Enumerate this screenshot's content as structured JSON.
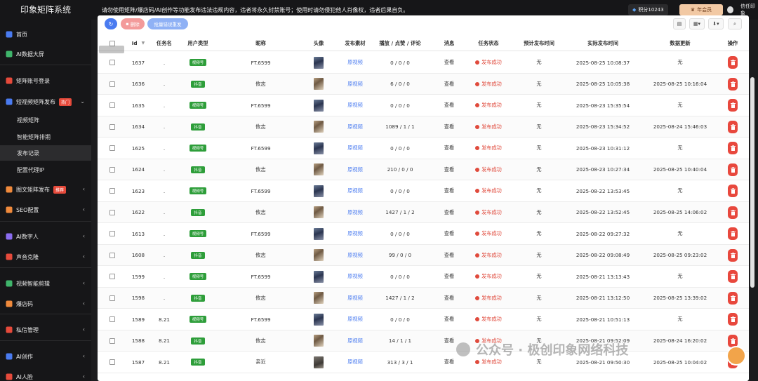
{
  "app": {
    "brand": "印象矩阵系统",
    "notice": "请勿使用矩阵/爆店码/AI创作等功能发布违法违规内容，违者将永久封禁账号；使用时请勿侵犯他人肖像权，违者后果自负。",
    "points": "积分10243",
    "vip_label": "年会员",
    "user_name": "信任印象"
  },
  "sidebar": {
    "items": [
      {
        "label": "首页",
        "icon": "home-icon"
      },
      {
        "label": "AI数据大屏",
        "icon": "screen-icon"
      },
      {
        "label": "矩阵账号登录",
        "icon": "account-icon"
      },
      {
        "label": "短视频矩阵发布",
        "icon": "video-icon",
        "badge": "热门"
      },
      {
        "label": "视频矩阵"
      },
      {
        "label": "智能矩阵排期"
      },
      {
        "label": "发布记录"
      },
      {
        "label": "配置代理IP"
      },
      {
        "label": "图文矩阵发布",
        "icon": "image-icon",
        "badge": "推荐"
      },
      {
        "label": "SEO配置",
        "icon": "seo-icon"
      },
      {
        "label": "AI数字人",
        "icon": "robot-icon"
      },
      {
        "label": "声音克隆",
        "icon": "voice-icon"
      },
      {
        "label": "视频智能剪辑",
        "icon": "clip-icon"
      },
      {
        "label": "爆店码",
        "icon": "qr-icon"
      },
      {
        "label": "私信管理",
        "icon": "message-icon"
      },
      {
        "label": "AI创作",
        "icon": "ai-icon"
      },
      {
        "label": "AI人脸",
        "icon": "face-icon"
      }
    ]
  },
  "toolbar": {
    "delete_label": "删除",
    "batch_label": "批量错误重发"
  },
  "table": {
    "headers": [
      "Id",
      "任务名",
      "用户类型",
      "昵称",
      "头像",
      "发布素材",
      "播放 / 点赞 / 评论",
      "消息",
      "任务状态",
      "预计发布时间",
      "实际发布时间",
      "数据更新",
      "操作"
    ],
    "rows": [
      {
        "id": "1637",
        "task": ".",
        "type": "视频号",
        "nick": "FT.6599",
        "avatar": "a",
        "material": "原视频",
        "stats": "0 / 0 / 0",
        "msg": "查看",
        "status": "发布成功",
        "planned": "无",
        "actual": "2025-08-25 10:08:37",
        "update": "无"
      },
      {
        "id": "1636",
        "task": ".",
        "type": "抖音",
        "nick": "攸志",
        "avatar": "b",
        "material": "原视频",
        "stats": "6 / 0 / 0",
        "msg": "查看",
        "status": "发布成功",
        "planned": "无",
        "actual": "2025-08-25 10:05:38",
        "update": "2025-08-25 10:16:04"
      },
      {
        "id": "1635",
        "task": ".",
        "type": "视频号",
        "nick": "FT.6599",
        "avatar": "a",
        "material": "原视频",
        "stats": "0 / 0 / 0",
        "msg": "查看",
        "status": "发布成功",
        "planned": "无",
        "actual": "2025-08-23 15:35:54",
        "update": "无"
      },
      {
        "id": "1634",
        "task": ".",
        "type": "抖音",
        "nick": "攸志",
        "avatar": "b",
        "material": "原视频",
        "stats": "1089 / 1 / 1",
        "msg": "查看",
        "status": "发布成功",
        "planned": "无",
        "actual": "2025-08-23 15:34:52",
        "update": "2025-08-24 15:46:03"
      },
      {
        "id": "1625",
        "task": ".",
        "type": "视频号",
        "nick": "FT.6599",
        "avatar": "a",
        "material": "原视频",
        "stats": "0 / 0 / 0",
        "msg": "查看",
        "status": "发布成功",
        "planned": "无",
        "actual": "2025-08-23 10:31:12",
        "update": "无"
      },
      {
        "id": "1624",
        "task": ".",
        "type": "抖音",
        "nick": "攸志",
        "avatar": "b",
        "material": "原视频",
        "stats": "210 / 0 / 0",
        "msg": "查看",
        "status": "发布成功",
        "planned": "无",
        "actual": "2025-08-23 10:27:34",
        "update": "2025-08-25 10:40:04"
      },
      {
        "id": "1623",
        "task": ".",
        "type": "视频号",
        "nick": "FT.6599",
        "avatar": "a",
        "material": "原视频",
        "stats": "0 / 0 / 0",
        "msg": "查看",
        "status": "发布成功",
        "planned": "无",
        "actual": "2025-08-22 13:53:45",
        "update": "无"
      },
      {
        "id": "1622",
        "task": ".",
        "type": "抖音",
        "nick": "攸志",
        "avatar": "b",
        "material": "原视频",
        "stats": "1427 / 1 / 2",
        "msg": "查看",
        "status": "发布成功",
        "planned": "无",
        "actual": "2025-08-22 13:52:45",
        "update": "2025-08-25 14:06:02"
      },
      {
        "id": "1613",
        "task": ".",
        "type": "视频号",
        "nick": "FT.6599",
        "avatar": "a",
        "material": "原视频",
        "stats": "0 / 0 / 0",
        "msg": "查看",
        "status": "发布成功",
        "planned": "无",
        "actual": "2025-08-22 09:27:32",
        "update": "无"
      },
      {
        "id": "1608",
        "task": ".",
        "type": "抖音",
        "nick": "攸志",
        "avatar": "b",
        "material": "原视频",
        "stats": "99 / 0 / 0",
        "msg": "查看",
        "status": "发布成功",
        "planned": "无",
        "actual": "2025-08-22 09:08:49",
        "update": "2025-08-25 09:23:02"
      },
      {
        "id": "1599",
        "task": ".",
        "type": "视频号",
        "nick": "FT.6599",
        "avatar": "a",
        "material": "原视频",
        "stats": "0 / 0 / 0",
        "msg": "查看",
        "status": "发布成功",
        "planned": "无",
        "actual": "2025-08-21 13:13:43",
        "update": "无"
      },
      {
        "id": "1598",
        "task": ".",
        "type": "抖音",
        "nick": "攸志",
        "avatar": "b",
        "material": "原视频",
        "stats": "1427 / 1 / 2",
        "msg": "查看",
        "status": "发布成功",
        "planned": "无",
        "actual": "2025-08-21 13:12:50",
        "update": "2025-08-25 13:39:02"
      },
      {
        "id": "1589",
        "task": "8.21",
        "type": "视频号",
        "nick": "FT.6599",
        "avatar": "a",
        "material": "原视频",
        "stats": "0 / 0 / 0",
        "msg": "查看",
        "status": "发布成功",
        "planned": "无",
        "actual": "2025-08-21 10:51:13",
        "update": "无"
      },
      {
        "id": "1588",
        "task": "8.21",
        "type": "抖音",
        "nick": "攸志",
        "avatar": "b",
        "material": "原视频",
        "stats": "14 / 1 / 1",
        "msg": "查看",
        "status": "发布成功",
        "planned": "无",
        "actual": "2025-08-21 09:52:09",
        "update": "2025-08-24 16:20:02"
      },
      {
        "id": "1587",
        "task": "8.21",
        "type": "抖音",
        "nick": "亲近",
        "avatar": "c",
        "material": "原视频",
        "stats": "313 / 3 / 1",
        "msg": "查看",
        "status": "发布成功",
        "planned": "无",
        "actual": "2025-08-21 09:50:30",
        "update": "2025-08-25 10:04:02"
      }
    ]
  },
  "watermark": {
    "text": "公众号 · 极创印象网络科技"
  },
  "colors": {
    "accent": "#4a7bf0",
    "danger": "#e04a3c",
    "tag_green": "#2e9e3a"
  }
}
